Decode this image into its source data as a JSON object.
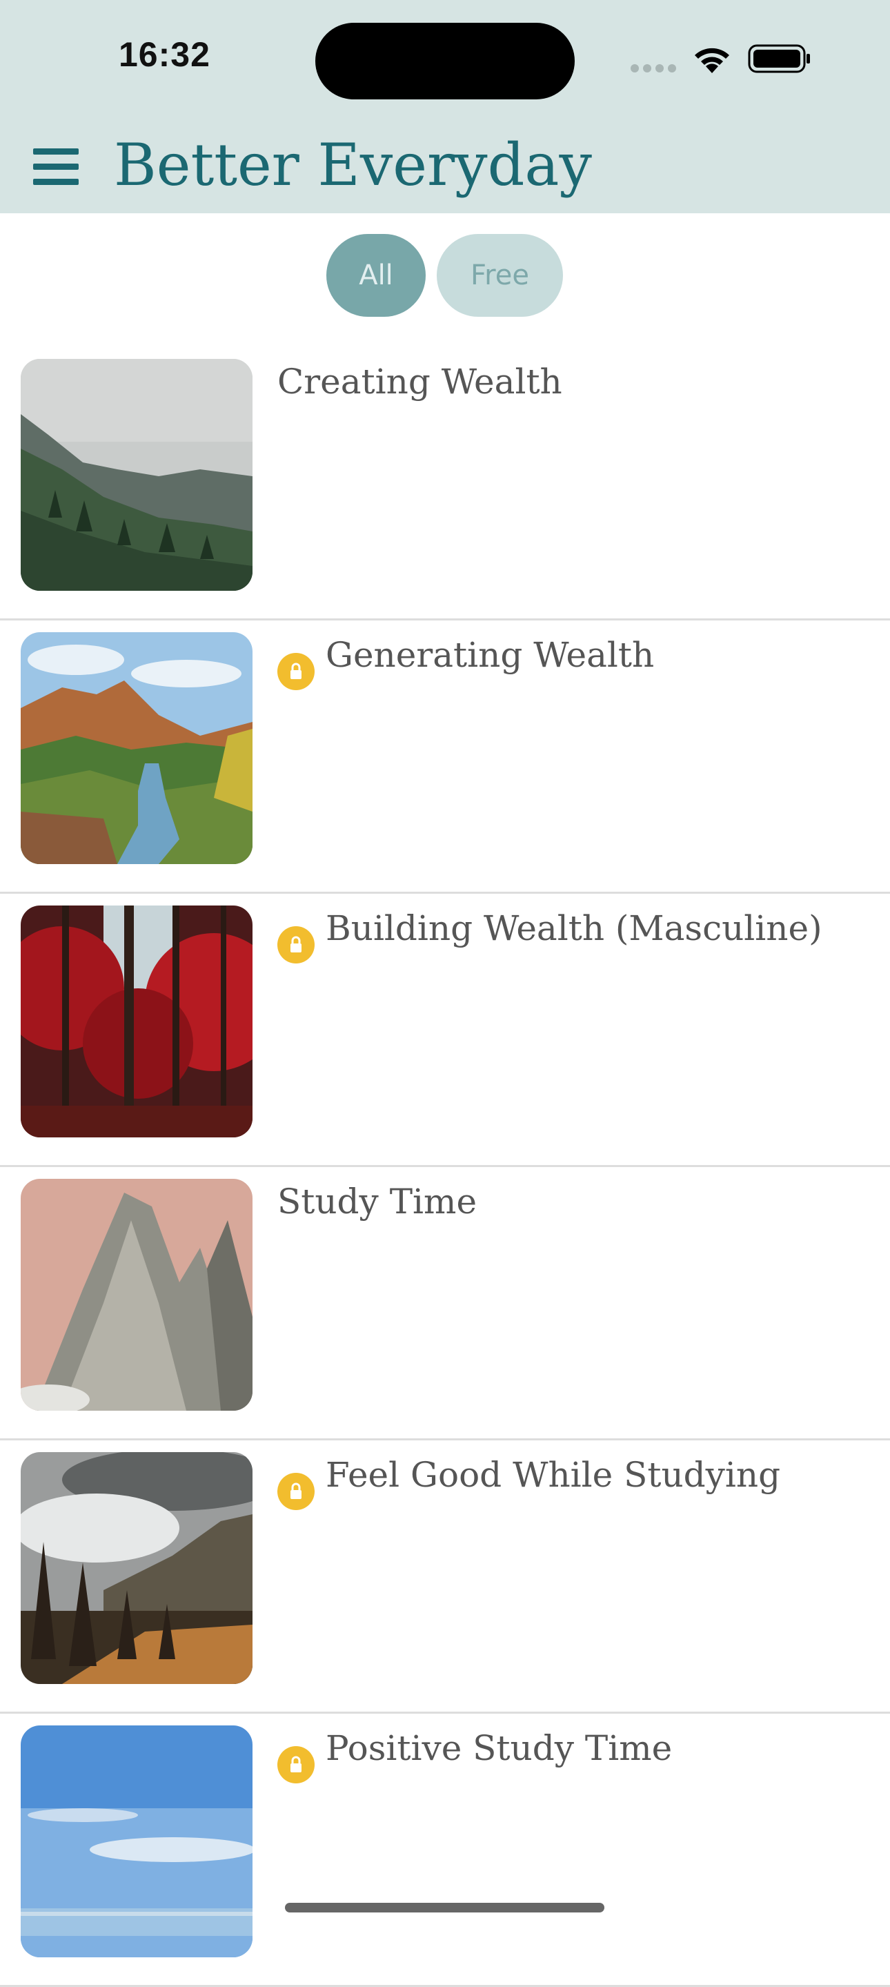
{
  "status_bar": {
    "time": "16:32",
    "icons": [
      "signal-dots-icon",
      "wifi-icon",
      "battery-icon"
    ]
  },
  "header": {
    "menu_icon": "hamburger-menu-icon",
    "title": "Better Everyday",
    "colors": {
      "background": "#d6e4e3",
      "title": "#1b6872"
    }
  },
  "filters": [
    {
      "label": "All",
      "selected": true
    },
    {
      "label": "Free",
      "selected": false
    }
  ],
  "items": [
    {
      "title": "Creating Wealth",
      "locked": false,
      "image": "misty-mountain-forest"
    },
    {
      "title": "Generating Wealth",
      "locked": true,
      "image": "canyon-river-valley"
    },
    {
      "title": "Building Wealth (Masculine)",
      "locked": true,
      "image": "red-autumn-forest"
    },
    {
      "title": "Study Time",
      "locked": false,
      "image": "rocky-mountain-peak"
    },
    {
      "title": "Feel Good While Studying",
      "locked": true,
      "image": "cloudy-pine-valley"
    },
    {
      "title": "Positive Study Time",
      "locked": true,
      "image": "blue-sky-sea"
    }
  ],
  "colors": {
    "lock_badge": "#f2bd2e",
    "item_title": "#555555",
    "divider": "#dddddd"
  }
}
